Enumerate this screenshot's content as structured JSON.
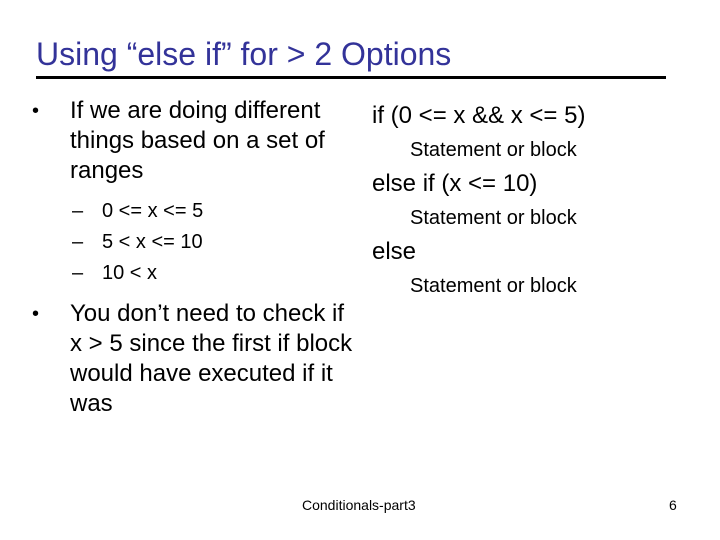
{
  "slide": {
    "title": "Using “else if” for > 2 Options",
    "title_color": "#333399",
    "left": {
      "bullets": [
        {
          "icon": "bullet-dot",
          "glyph": "•",
          "text": "If we are doing different things based on a set of ranges",
          "sub_items": [
            {
              "dash": "–",
              "text": "0 <= x <= 5"
            },
            {
              "dash": "–",
              "text": "5 < x <= 10"
            },
            {
              "dash": "–",
              "text": "10 < x"
            }
          ]
        },
        {
          "icon": "bullet-dot",
          "glyph": "•",
          "text": "You don’t need to check if x > 5 since the first if block would have executed if it was"
        }
      ]
    },
    "right": {
      "code": [
        {
          "type": "condition",
          "text": "if (0 <= x && x <= 5)"
        },
        {
          "type": "statement",
          "text": "Statement or block"
        },
        {
          "type": "condition",
          "text": "else if (x <= 10)"
        },
        {
          "type": "statement",
          "text": "Statement or block"
        },
        {
          "type": "condition",
          "text": "else"
        },
        {
          "type": "statement",
          "text": "Statement or block"
        }
      ]
    },
    "footer": {
      "center": "Conditionals-part3",
      "page_number": "6"
    }
  }
}
